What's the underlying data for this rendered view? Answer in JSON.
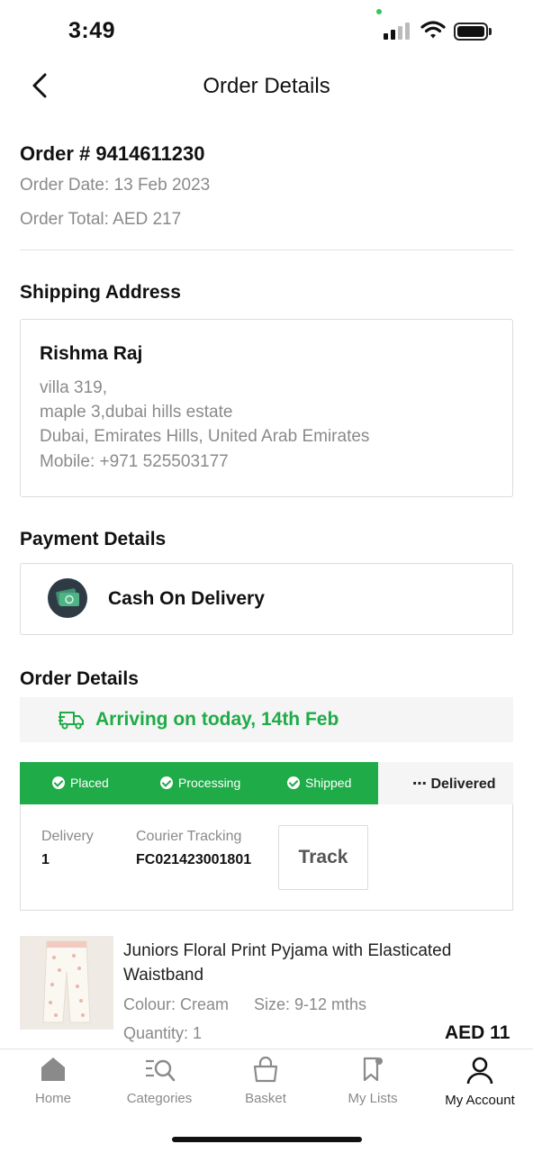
{
  "status_bar": {
    "time": "3:49"
  },
  "header": {
    "title": "Order Details"
  },
  "order": {
    "number": "Order # 9414611230",
    "date": "Order Date: 13 Feb 2023",
    "total": "Order Total: AED 217"
  },
  "shipping": {
    "section_title": "Shipping Address",
    "name": "Rishma Raj",
    "line1": "villa 319,",
    "line2": "maple 3,dubai hills estate",
    "line3": "Dubai, Emirates Hills, United Arab Emirates",
    "mobile": "Mobile: +971 525503177"
  },
  "payment": {
    "section_title": "Payment Details",
    "method": "Cash On Delivery"
  },
  "order_details": {
    "section_title": "Order Details",
    "arriving": "Arriving on today, 14th Feb",
    "steps": [
      {
        "label": "Placed",
        "done": true
      },
      {
        "label": "Processing",
        "done": true
      },
      {
        "label": "Shipped",
        "done": true
      },
      {
        "label": "Delivered",
        "done": false
      }
    ],
    "delivery_label": "Delivery",
    "delivery_value": "1",
    "courier_label": "Courier Tracking",
    "courier_value": "FC021423001801",
    "track_button": "Track"
  },
  "product": {
    "name": "Juniors Floral Print Pyjama with Elasticated Waistband",
    "colour": "Colour: Cream",
    "size": "Size: 9-12 mths",
    "quantity": "Quantity: 1",
    "price": "AED 11"
  },
  "nav": {
    "items": [
      {
        "label": "Home",
        "icon": "home-icon",
        "active": false
      },
      {
        "label": "Categories",
        "icon": "categories-icon",
        "active": false
      },
      {
        "label": "Basket",
        "icon": "basket-icon",
        "active": false
      },
      {
        "label": "My Lists",
        "icon": "bookmark-icon",
        "active": false
      },
      {
        "label": "My Account",
        "icon": "account-icon",
        "active": true
      }
    ]
  },
  "colors": {
    "accent_green": "#1fab48",
    "muted_text": "#8a8a8a"
  }
}
